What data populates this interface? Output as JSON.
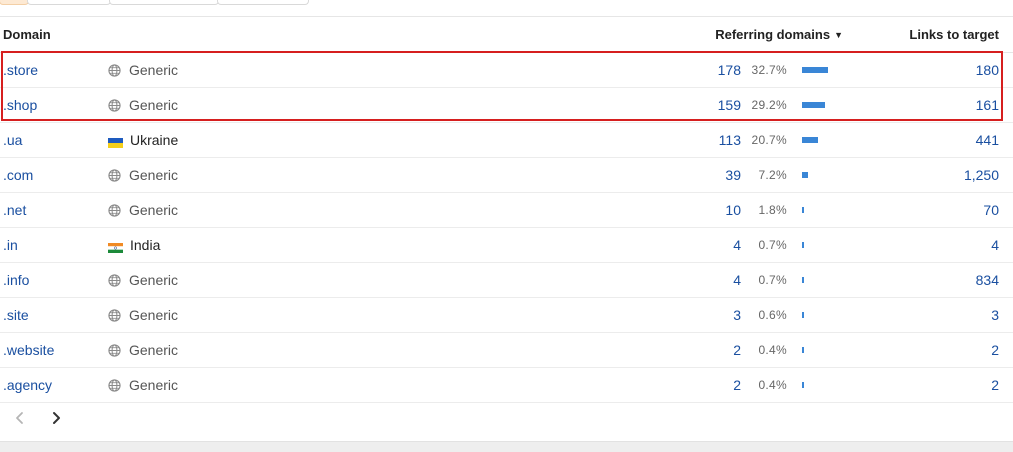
{
  "table": {
    "headers": {
      "domain": "Domain",
      "referring_domains": "Referring domains",
      "links_to_target": "Links to target"
    },
    "sort": {
      "column": "referring_domains",
      "direction": "desc"
    },
    "rows": [
      {
        "tld": ".store",
        "region": "Generic",
        "region_icon": "globe-icon",
        "ref_domains": "178",
        "ref_pct": "32.7%",
        "ref_fraction": 0.327,
        "links": "180"
      },
      {
        "tld": ".shop",
        "region": "Generic",
        "region_icon": "globe-icon",
        "ref_domains": "159",
        "ref_pct": "29.2%",
        "ref_fraction": 0.292,
        "links": "161"
      },
      {
        "tld": ".ua",
        "region": "Ukraine",
        "region_icon": "flag-ukraine-icon",
        "ref_domains": "113",
        "ref_pct": "20.7%",
        "ref_fraction": 0.207,
        "links": "441"
      },
      {
        "tld": ".com",
        "region": "Generic",
        "region_icon": "globe-icon",
        "ref_domains": "39",
        "ref_pct": "7.2%",
        "ref_fraction": 0.072,
        "links": "1,250"
      },
      {
        "tld": ".net",
        "region": "Generic",
        "region_icon": "globe-icon",
        "ref_domains": "10",
        "ref_pct": "1.8%",
        "ref_fraction": 0.018,
        "links": "70"
      },
      {
        "tld": ".in",
        "region": "India",
        "region_icon": "flag-india-icon",
        "ref_domains": "4",
        "ref_pct": "0.7%",
        "ref_fraction": 0.007,
        "links": "4"
      },
      {
        "tld": ".info",
        "region": "Generic",
        "region_icon": "globe-icon",
        "ref_domains": "4",
        "ref_pct": "0.7%",
        "ref_fraction": 0.007,
        "links": "834"
      },
      {
        "tld": ".site",
        "region": "Generic",
        "region_icon": "globe-icon",
        "ref_domains": "3",
        "ref_pct": "0.6%",
        "ref_fraction": 0.006,
        "links": "3"
      },
      {
        "tld": ".website",
        "region": "Generic",
        "region_icon": "globe-icon",
        "ref_domains": "2",
        "ref_pct": "0.4%",
        "ref_fraction": 0.004,
        "links": "2"
      },
      {
        "tld": ".agency",
        "region": "Generic",
        "region_icon": "globe-icon",
        "ref_domains": "2",
        "ref_pct": "0.4%",
        "ref_fraction": 0.004,
        "links": "2"
      }
    ]
  },
  "highlighted_rows": [
    ".store",
    ".shop"
  ],
  "pagination": {
    "prev_icon": "chevron-left-icon",
    "next_icon": "chevron-right-icon"
  },
  "colors": {
    "link": "#1a4fa0",
    "bar": "#3a86d6",
    "highlight_border": "#d61f1f",
    "active_tab": "#fde9d3"
  }
}
